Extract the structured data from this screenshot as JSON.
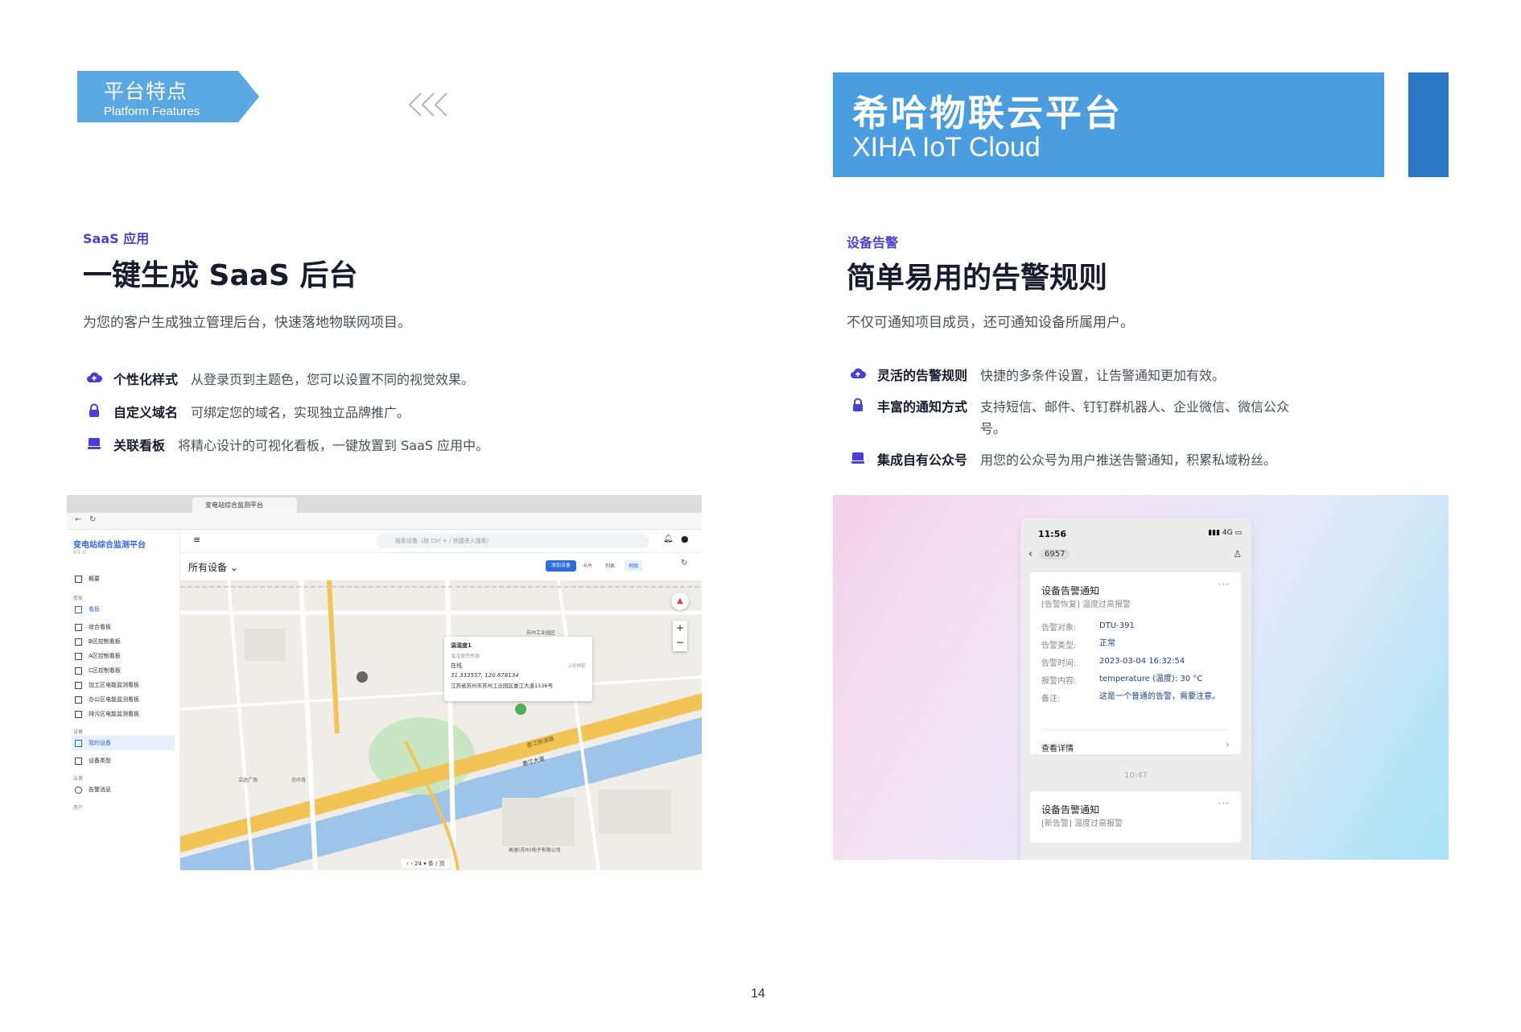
{
  "header": {
    "tag_title": "平台特点",
    "tag_subtitle": "Platform Features",
    "brand_cn": "希哈物联云平台",
    "brand_en": "XIHA IoT Cloud"
  },
  "colors": {
    "tag_blue": "#5aa7e2",
    "brand_blue": "#4a9ee0",
    "brand_bar": "#2a78c3",
    "accent_purple": "#4c3fd6"
  },
  "left_section": {
    "eyebrow": "SaaS 应用",
    "heading": "一键生成 SaaS 后台",
    "description": "为您的客户生成独立管理后台，快速落地物联网项目。",
    "features": [
      {
        "icon": "cloud-upload-icon",
        "name": "个性化样式",
        "text": "从登录页到主题色，您可以设置不同的视觉效果。"
      },
      {
        "icon": "lock-icon",
        "name": "自定义域名",
        "text": "可绑定您的域名，实现独立品牌推广。"
      },
      {
        "icon": "dashboard-icon",
        "name": "关联看板",
        "text": "将精心设计的可视化看板，一键放置到 SaaS 应用中。"
      }
    ]
  },
  "right_section": {
    "eyebrow": "设备告警",
    "heading": "简单易用的告警规则",
    "description": "不仅可通知项目成员，还可通知设备所属用户。",
    "features": [
      {
        "icon": "cloud-upload-icon",
        "name": "灵活的告警规则",
        "text": "快捷的多条件设置，让告警通知更加有效。"
      },
      {
        "icon": "lock-icon",
        "name": "丰富的通知方式",
        "text": "支持短信、邮件、钉钉群机器人、企业微信、微信公众号。"
      },
      {
        "icon": "dashboard-icon",
        "name": "集成自有公众号",
        "text": "用您的公众号为用户推送告警通知，积累私域粉丝。"
      }
    ]
  },
  "screenshot": {
    "tab_title": "变电站综合监测平台",
    "app_title": "变电站综合监测平台",
    "version": "V1.0",
    "search_placeholder": "搜索设备（按 Ctrl + / 快捷进入搜索）",
    "filter_label": "所有设备",
    "add_device": "添加设备",
    "view_modes": [
      "卡片",
      "列表",
      "地图"
    ],
    "nav_overview": "概要",
    "group_dashboard": "看板",
    "group_device": "设备",
    "group_alarm": "告警",
    "group_user": "用户",
    "menu": [
      "看板",
      "综合看板",
      "B区控制看板",
      "A区控制看板",
      "C区控制看板",
      "加工区电能监测看板",
      "办公区电能监测看板",
      "排污区电能监测看板"
    ],
    "device_menu": [
      "我的设备",
      "设备类型"
    ],
    "alarm_menu": [
      "告警消息"
    ],
    "popup": {
      "name": "温湿度1",
      "sub": "温湿度传感器",
      "status": "在线",
      "updated": "1分钟前",
      "coords": "31.333557, 120.678134",
      "address": "江苏省苏州市苏州工业园区娄江大道1536号"
    },
    "map_labels": [
      "娄江快速路",
      "娄江大道",
      "苏州工业园区",
      "南岸路",
      "立达广场",
      "高速(苏州)电子有限公司"
    ],
    "pagination": "24",
    "per_page": "条 / 页"
  },
  "phone": {
    "time": "11:56",
    "signal": "4G",
    "contact": "6957",
    "card1": {
      "title": "设备告警通知",
      "subtitle": "[告警恢复] 温度过高报警",
      "rows": [
        {
          "k": "告警对象:",
          "v": "DTU-391"
        },
        {
          "k": "告警类型:",
          "v": "正常"
        },
        {
          "k": "告警时间:",
          "v": "2023-03-04 16:32:54"
        },
        {
          "k": "报警内容:",
          "v": "temperature (温度): 30 °C"
        },
        {
          "k": "备注:",
          "v": "这是一个普通的告警，需要注意。"
        }
      ],
      "more": "查看详情"
    },
    "divider_time": "10:47",
    "card2": {
      "title": "设备告警通知",
      "subtitle": "[新告警] 温度过高报警"
    }
  },
  "page_number": "14"
}
